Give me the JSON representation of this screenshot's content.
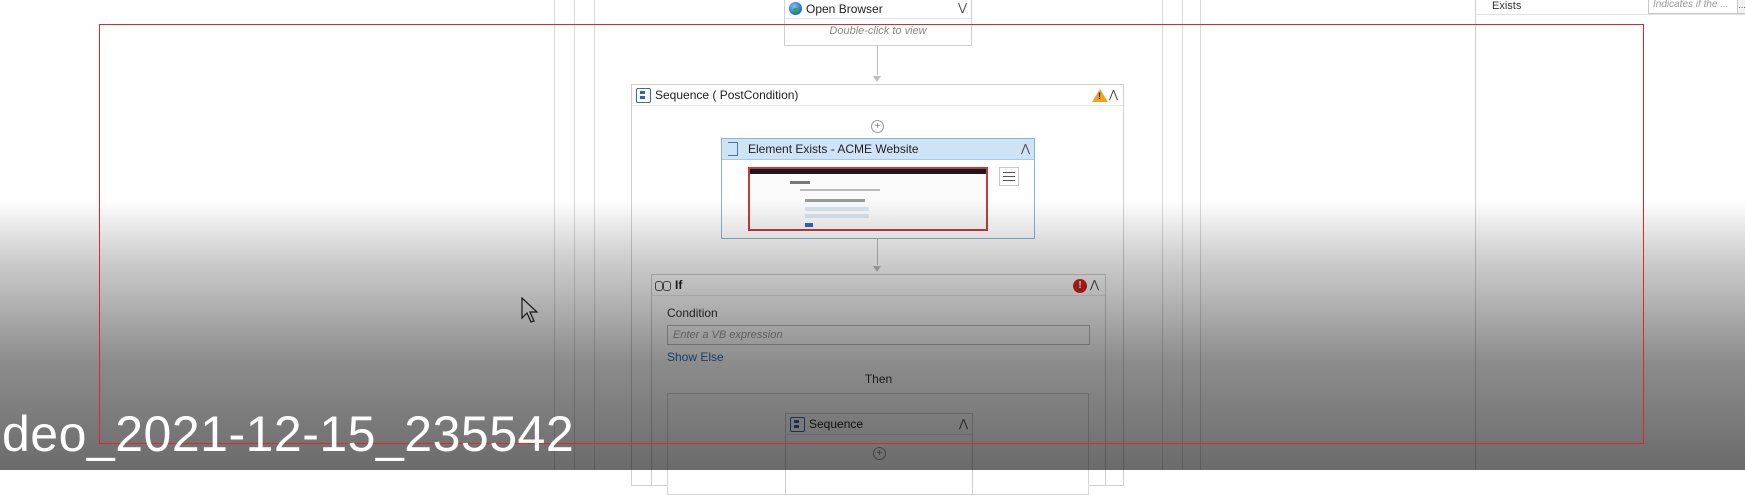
{
  "open_browser": {
    "title": "Open Browser",
    "hint": "Double-click to view"
  },
  "sequence_post": {
    "title": "Sequence ( PostCondition)"
  },
  "element_exists": {
    "title": "Element Exists - ACME Website"
  },
  "if_block": {
    "title": "If",
    "condition_label": "Condition",
    "condition_placeholder": "Enter a VB expression",
    "show_else": "Show Else",
    "then_label": "Then"
  },
  "inner_sequence": {
    "title": "Sequence"
  },
  "properties": {
    "name": "Exists",
    "value_placeholder": "Indicates if the ...",
    "button": "..."
  },
  "watermark": "deo_2021-12-15_235542",
  "colors": {
    "selection_rect": "#e0262c",
    "warning": "#f2a21c",
    "error": "#d62020",
    "link": "#2f6db5"
  }
}
